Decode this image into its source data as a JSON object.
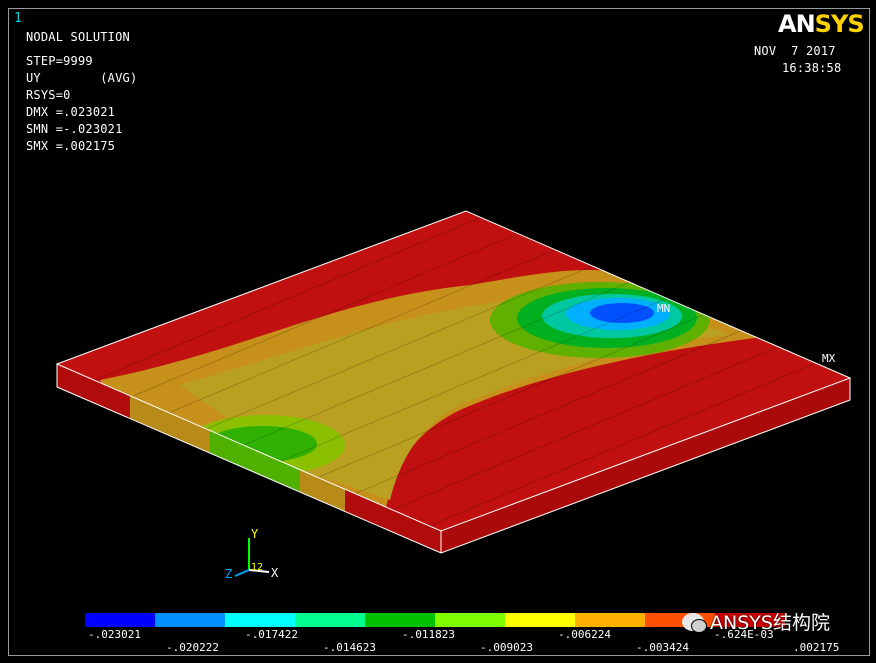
{
  "window": {
    "number": "1"
  },
  "info": {
    "title": "NODAL SOLUTION",
    "step": "STEP=9999",
    "result": "UY        (AVG)",
    "rsys": "RSYS=0",
    "dmx": "DMX =.023021",
    "smn": "SMN =-.023021",
    "smx": "SMX =.002175"
  },
  "date": "NOV  7 2017",
  "time": "16:38:58",
  "logo": {
    "part1": "AN",
    "part2": "SYS"
  },
  "markers": {
    "min": "MN",
    "max": "MX"
  },
  "triad": {
    "y": "Y",
    "x": "X",
    "z": "Z",
    "num": "12"
  },
  "legend": {
    "colors": [
      "#0000ff",
      "#0090ff",
      "#00ffff",
      "#00ff90",
      "#00c000",
      "#80ff00",
      "#ffff00",
      "#ffb000",
      "#ff5000",
      "#d00000"
    ],
    "upper_labels": [
      "-.023021",
      "-.017422",
      "-.011823",
      "-.006224",
      "-.624E-03"
    ],
    "lower_labels": [
      "-.020222",
      "-.014623",
      "-.009023",
      "-.003424",
      ".002175"
    ]
  },
  "watermark": {
    "text": "ANSYS结构院"
  },
  "colors": {
    "plate_red": "#cc1111",
    "plate_orange": "#c88a10",
    "edge": "#ffffff"
  }
}
